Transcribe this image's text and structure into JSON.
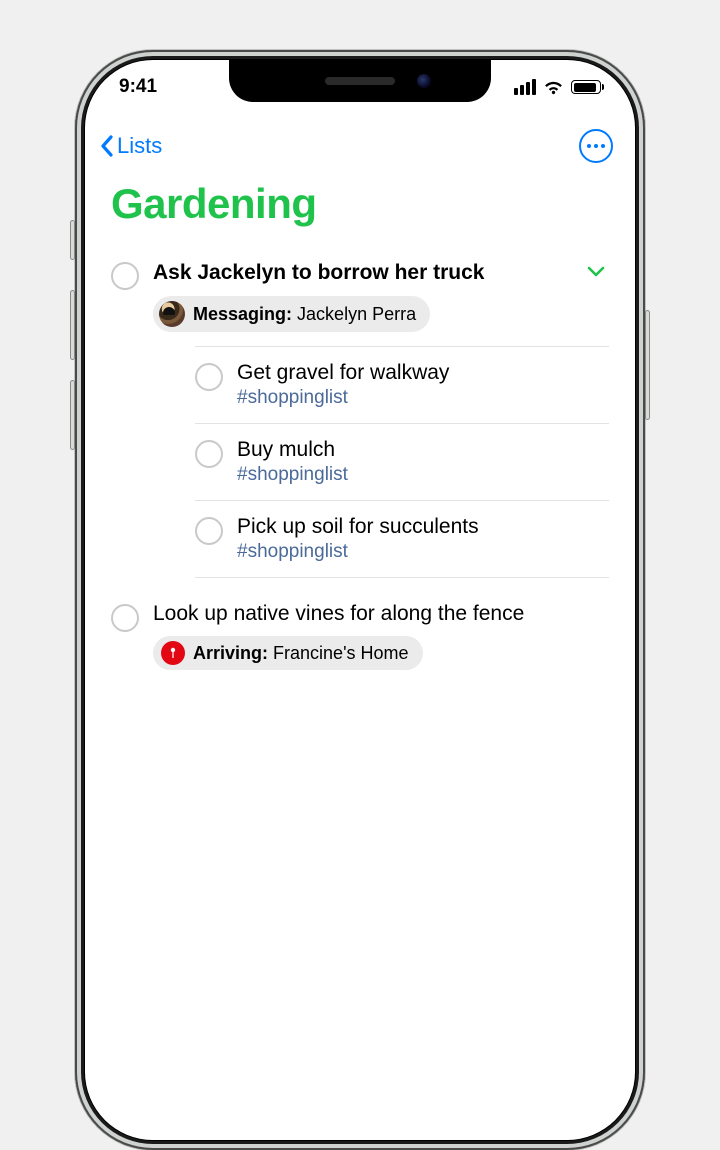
{
  "status": {
    "time": "9:41"
  },
  "nav": {
    "back_label": "Lists"
  },
  "list": {
    "title": "Gardening",
    "accent_color": "#1fc24a"
  },
  "items": [
    {
      "title": "Ask Jackelyn to borrow her truck",
      "bold": true,
      "expanded": true,
      "chip": {
        "kind": "messaging",
        "label": "Messaging:",
        "value": "Jackelyn Perra"
      },
      "subitems": [
        {
          "title": "Get gravel for walkway",
          "tag": "#shoppinglist"
        },
        {
          "title": "Buy mulch",
          "tag": "#shoppinglist"
        },
        {
          "title": "Pick up soil for succulents",
          "tag": "#shoppinglist"
        }
      ]
    },
    {
      "title": "Look up native vines for along the fence",
      "chip": {
        "kind": "arriving",
        "label": "Arriving:",
        "value": "Francine's Home"
      }
    }
  ]
}
